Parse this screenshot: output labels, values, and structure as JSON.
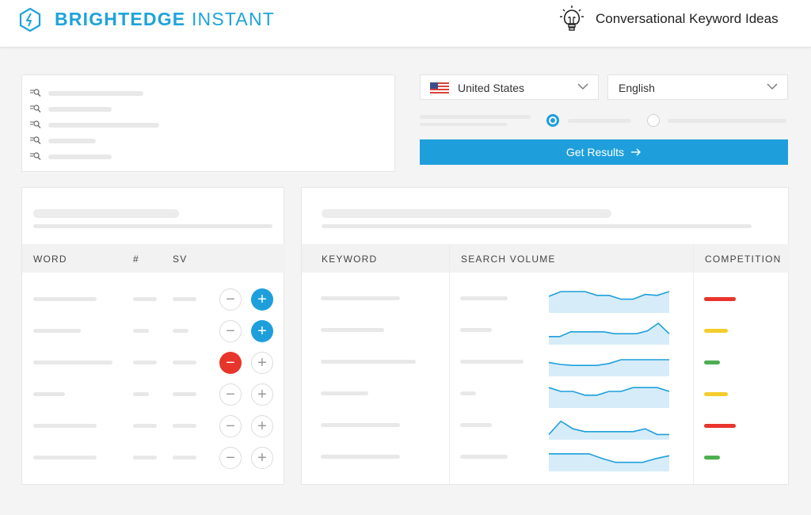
{
  "header": {
    "brand_bold": "BRIGHTEDGE",
    "brand_light": "INSTANT",
    "title": "Conversational Keyword Ideas",
    "logo_icon": "brightedge-logo-icon",
    "title_icon": "lightbulb-icon"
  },
  "controls": {
    "country": "United States",
    "country_flag": "us-flag-icon",
    "language": "English",
    "submit_label": "Get Results",
    "selected_option_index": 0
  },
  "word_table": {
    "columns": [
      "WORD",
      "#",
      "SV"
    ],
    "rows": [
      {
        "included": false,
        "excluded": false,
        "add_active": true
      },
      {
        "included": false,
        "excluded": false,
        "add_active": true
      },
      {
        "included": false,
        "excluded": true,
        "add_active": false
      },
      {
        "included": false,
        "excluded": false,
        "add_active": false
      },
      {
        "included": false,
        "excluded": false,
        "add_active": false
      },
      {
        "included": false,
        "excluded": false,
        "add_active": false
      }
    ]
  },
  "keyword_table": {
    "columns": [
      "KEYWORD",
      "SEARCH VOLUME",
      "COMPETITION"
    ],
    "rows": [
      {
        "trend": [
          0.75,
          1,
          1,
          1,
          0.8,
          0.8,
          0.6,
          0.6,
          0.85,
          0.8,
          1
        ],
        "competition": "high"
      },
      {
        "trend": [
          0.3,
          0.3,
          0.55,
          0.55,
          0.55,
          0.55,
          0.45,
          0.45,
          0.45,
          0.6,
          1,
          0.45
        ],
        "competition": "medium"
      },
      {
        "trend": [
          0.6,
          0.5,
          0.45,
          0.45,
          0.45,
          0.55,
          0.75,
          0.75,
          0.75,
          0.75,
          0.75
        ],
        "competition": "low"
      },
      {
        "trend": [
          0.95,
          0.75,
          0.75,
          0.55,
          0.55,
          0.75,
          0.75,
          0.95,
          0.95,
          0.95,
          0.75
        ],
        "competition": "medium"
      },
      {
        "trend": [
          0.15,
          0.85,
          0.45,
          0.3,
          0.3,
          0.3,
          0.3,
          0.3,
          0.45,
          0.15,
          0.15
        ],
        "competition": "high"
      },
      {
        "trend": [
          0.8,
          0.8,
          0.8,
          0.8,
          0.55,
          0.35,
          0.35,
          0.35,
          0.55,
          0.7
        ],
        "competition": "low"
      }
    ]
  },
  "colors": {
    "accent": "#1e9fdb",
    "danger": "#e8352b",
    "competition_high": "#e8352b",
    "competition_medium": "#f4cd2a",
    "competition_low": "#4caf50",
    "spark_fill": "#d6ecf8"
  }
}
